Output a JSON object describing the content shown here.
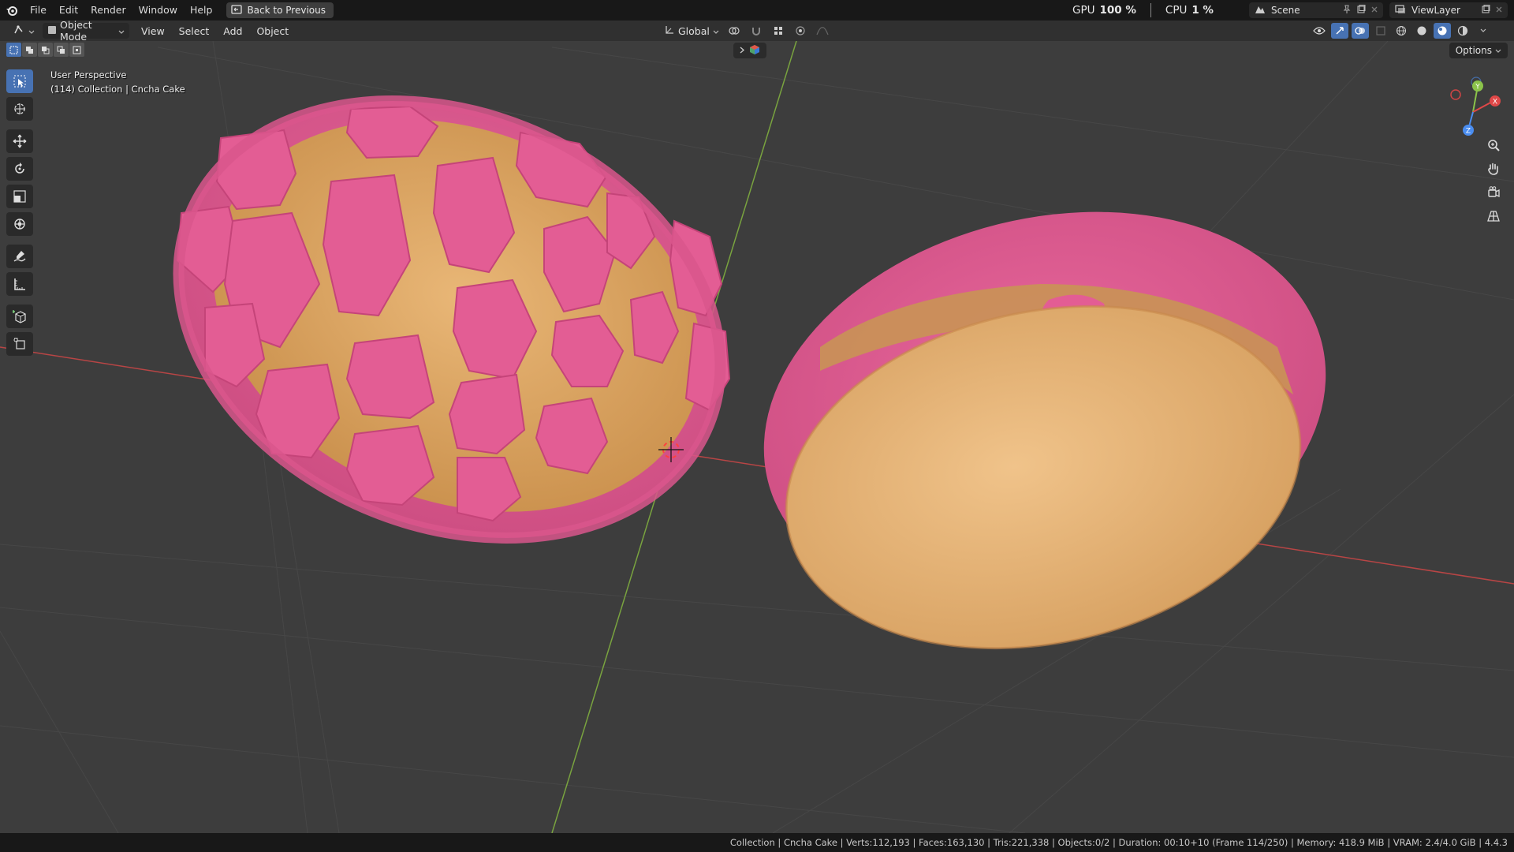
{
  "menu": {
    "items": [
      "File",
      "Edit",
      "Render",
      "Window",
      "Help"
    ],
    "back_label": "Back to Previous"
  },
  "perf": {
    "gpu_label": "GPU",
    "gpu_value": "100 %",
    "cpu_label": "CPU",
    "cpu_value": "1 %"
  },
  "scene": {
    "name": "Scene",
    "view_layer": "ViewLayer"
  },
  "viewport_header": {
    "mode": "Object Mode",
    "menus": [
      "View",
      "Select",
      "Add",
      "Object"
    ],
    "transform_orientation": "Global",
    "options_label": "Options"
  },
  "overlay": {
    "perspective": "User Perspective",
    "collection_info": "(114) Collection | Cncha Cake"
  },
  "gizmo": {
    "y": "Y",
    "x": "X",
    "z": "Z"
  },
  "status": {
    "text": "Collection | Cncha Cake | Verts:112,193 | Faces:163,130 | Tris:221,338 | Objects:0/2 | Duration: 00:10+10 (Frame 114/250) | Memory: 418.9 MiB | VRAM: 2.4/4.0 GiB | 4.4.3"
  },
  "colors": {
    "accent": "#4772b3",
    "viewport_bg": "#3d3d3d",
    "topping_pink": "#e0578f",
    "bread": "#e6ad6a",
    "x_axis": "#c74848",
    "y_axis": "#7fa542"
  }
}
